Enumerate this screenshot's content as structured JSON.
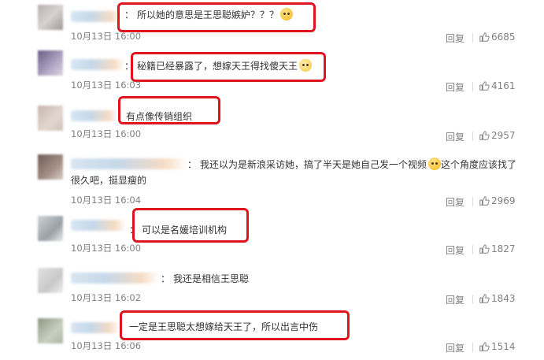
{
  "colors": {
    "highlight_box": "#e0141e",
    "meta_text": "#808080",
    "body_text": "#333333"
  },
  "comments": [
    {
      "text": "所以她的意思是王思聪嫉妒？？？",
      "emoji": "shocked-face",
      "time": "10月13日 16:00",
      "reply": "回复",
      "likes": "6685",
      "highlighted": true
    },
    {
      "text": "秘籍已经暴露了，想嫁天王得找傻天王",
      "emoji": "cat-face",
      "time": "10月13日 16:03",
      "reply": "回复",
      "likes": "4161",
      "highlighted": true
    },
    {
      "text": "有点像传销组织",
      "time": "10月13日 16:00",
      "reply": "回复",
      "likes": "2957",
      "highlighted": true
    },
    {
      "text_line1": "我还以为是新浪采访她，搞了半天是她自己发一个视频",
      "emoji": "flushed-face",
      "text_line1_tail": "这个角度应该找了",
      "text_line2": "很久吧，挺显瘦的",
      "time": "10月13日 16:04",
      "reply": "回复",
      "likes": "2969",
      "highlighted": false
    },
    {
      "text": "可以是名媛培训机构",
      "time": "10月13日 16:00",
      "reply": "回复",
      "likes": "1827",
      "highlighted": true
    },
    {
      "text": "我还是相信王思聪",
      "time": "10月13日 16:02",
      "reply": "回复",
      "likes": "1843",
      "highlighted": false
    },
    {
      "text": "一定是王思聪太想嫁给天王了，所以出言中伤",
      "time": "10月13日 16:06",
      "reply": "回复",
      "likes": "1514",
      "highlighted": true
    }
  ],
  "colon": "："
}
